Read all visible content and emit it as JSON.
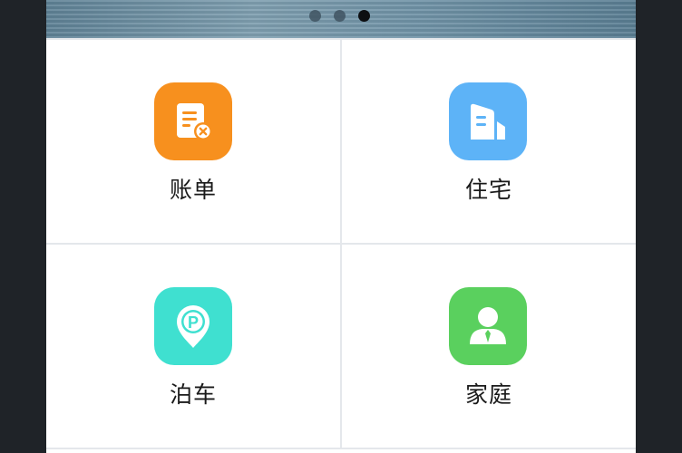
{
  "banner": {
    "slides": 3,
    "active_index": 2
  },
  "grid": {
    "items": [
      {
        "label": "账单",
        "icon": "bill-icon",
        "color": "#f7901e"
      },
      {
        "label": "住宅",
        "icon": "building-icon",
        "color": "#5db3f7"
      },
      {
        "label": "泊车",
        "icon": "parking-pin-icon",
        "color": "#3fe0d0"
      },
      {
        "label": "家庭",
        "icon": "person-icon",
        "color": "#5ad05e"
      }
    ]
  }
}
